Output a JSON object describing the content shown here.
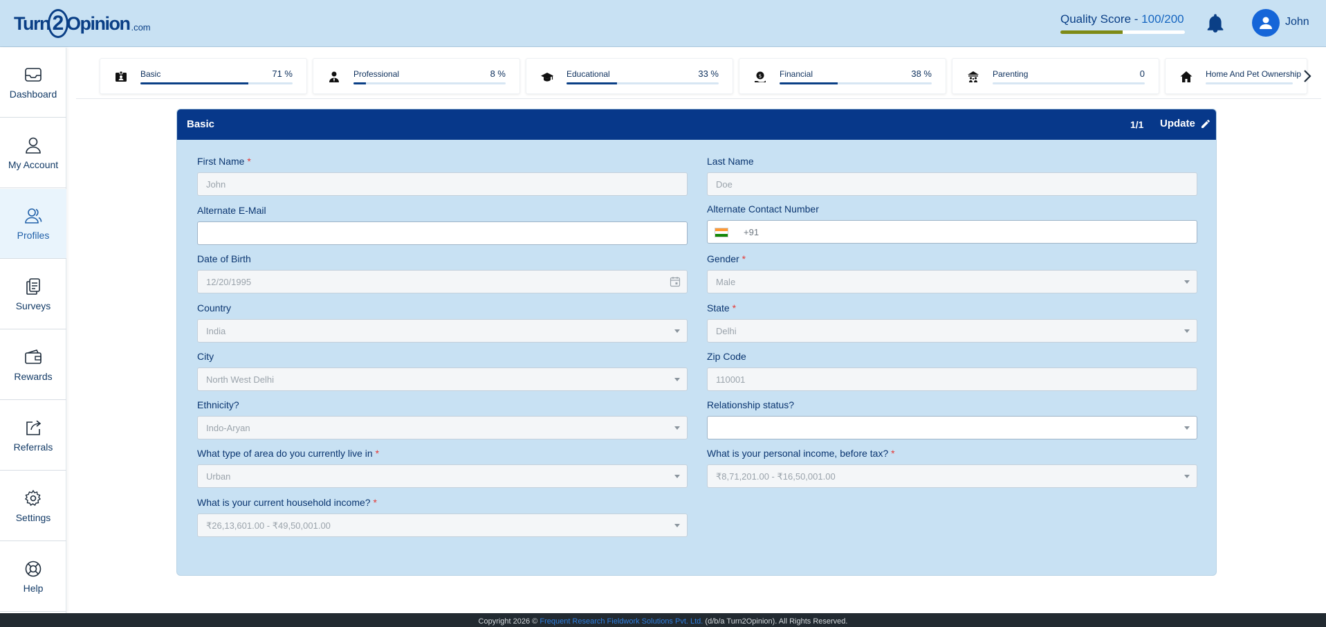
{
  "header": {
    "logo": {
      "part1": "Turn",
      "part2": "2",
      "part3": "Opinion",
      "suffix": ".com"
    },
    "quality_score": {
      "label": "Quality Score - ",
      "value": "100/200",
      "progress_percent": 50,
      "bar_color": "#7e8a16"
    },
    "user_name": "John",
    "icons": {
      "notifications": "bell-icon",
      "avatar": "user-avatar-icon"
    }
  },
  "sidebar": {
    "items": [
      {
        "label": "Dashboard",
        "icon": "inbox-icon",
        "active": false
      },
      {
        "label": "My Account",
        "icon": "user-icon",
        "active": false
      },
      {
        "label": "Profiles",
        "icon": "users-icon",
        "active": true
      },
      {
        "label": "Surveys",
        "icon": "documents-icon",
        "active": false
      },
      {
        "label": "Rewards",
        "icon": "wallet-icon",
        "active": false
      },
      {
        "label": "Referrals",
        "icon": "share-icon",
        "active": false
      },
      {
        "label": "Settings",
        "icon": "gear-icon",
        "active": false
      },
      {
        "label": "Help",
        "icon": "lifebuoy-icon",
        "active": false
      }
    ]
  },
  "tabs": [
    {
      "label": "Basic",
      "percent_text": "71 %",
      "progress": 71,
      "icon": "id-card-icon"
    },
    {
      "label": "Professional",
      "percent_text": "8 %",
      "progress": 8,
      "icon": "person-tie-icon"
    },
    {
      "label": "Educational",
      "percent_text": "33 %",
      "progress": 33,
      "icon": "graduation-cap-icon"
    },
    {
      "label": "Financial",
      "percent_text": "38 %",
      "progress": 38,
      "icon": "money-hand-icon"
    },
    {
      "label": "Parenting",
      "percent_text": "0",
      "progress": 0,
      "icon": "family-icon"
    },
    {
      "label": "Home And Pet Ownership",
      "percent_text": "",
      "progress": 0,
      "icon": "home-icon"
    }
  ],
  "panel": {
    "title": "Basic",
    "page": "1/1",
    "update_label": "Update",
    "fields": {
      "first_name": {
        "label": "First Name",
        "required": "*",
        "value": "John",
        "type": "text"
      },
      "last_name": {
        "label": "Last Name",
        "value": "Doe",
        "type": "text"
      },
      "alt_email": {
        "label": "Alternate E-Mail",
        "value": "",
        "type": "text"
      },
      "alt_phone": {
        "label": "Alternate Contact Number",
        "country_code": "+91",
        "flag": "india-flag",
        "type": "phone"
      },
      "dob": {
        "label": "Date of Birth",
        "value": "12/20/1995",
        "type": "date"
      },
      "gender": {
        "label": "Gender",
        "required": "*",
        "value": "Male",
        "type": "select"
      },
      "country": {
        "label": "Country",
        "value": "India",
        "type": "select"
      },
      "state": {
        "label": "State",
        "required": "*",
        "value": "Delhi",
        "type": "select"
      },
      "city": {
        "label": "City",
        "value": "North West Delhi",
        "type": "select"
      },
      "zip": {
        "label": "Zip Code",
        "value": "110001",
        "type": "text"
      },
      "ethnicity": {
        "label": "Ethnicity?",
        "value": "Indo-Aryan",
        "type": "select"
      },
      "relationship": {
        "label": "Relationship status?",
        "value": "",
        "type": "select"
      },
      "area_type": {
        "label": "What type of area do you currently live in",
        "required": "*",
        "value": "Urban",
        "type": "select"
      },
      "personal_income": {
        "label": "What is your personal income, before tax?",
        "required": "*",
        "value": "₹8,71,201.00 - ₹16,50,001.00",
        "type": "select"
      },
      "household_income": {
        "label": "What is your current household income?",
        "required": "*",
        "value": "₹26,13,601.00 - ₹49,50,001.00",
        "type": "select"
      }
    }
  },
  "footer": {
    "prefix": "Copyright 2026 © ",
    "company": "Frequent Research Fieldwork Solutions Pvt. Ltd.",
    "suffix": " (d/b/a Turn2Opinion). All Rights Reserved."
  },
  "colors": {
    "header_bg": "#c8e1f3",
    "panel_header": "#07388a",
    "panel_bg": "#c8e1f3",
    "accent": "#0a3f86",
    "required": "#e53935",
    "footer_bg": "#222a31"
  }
}
